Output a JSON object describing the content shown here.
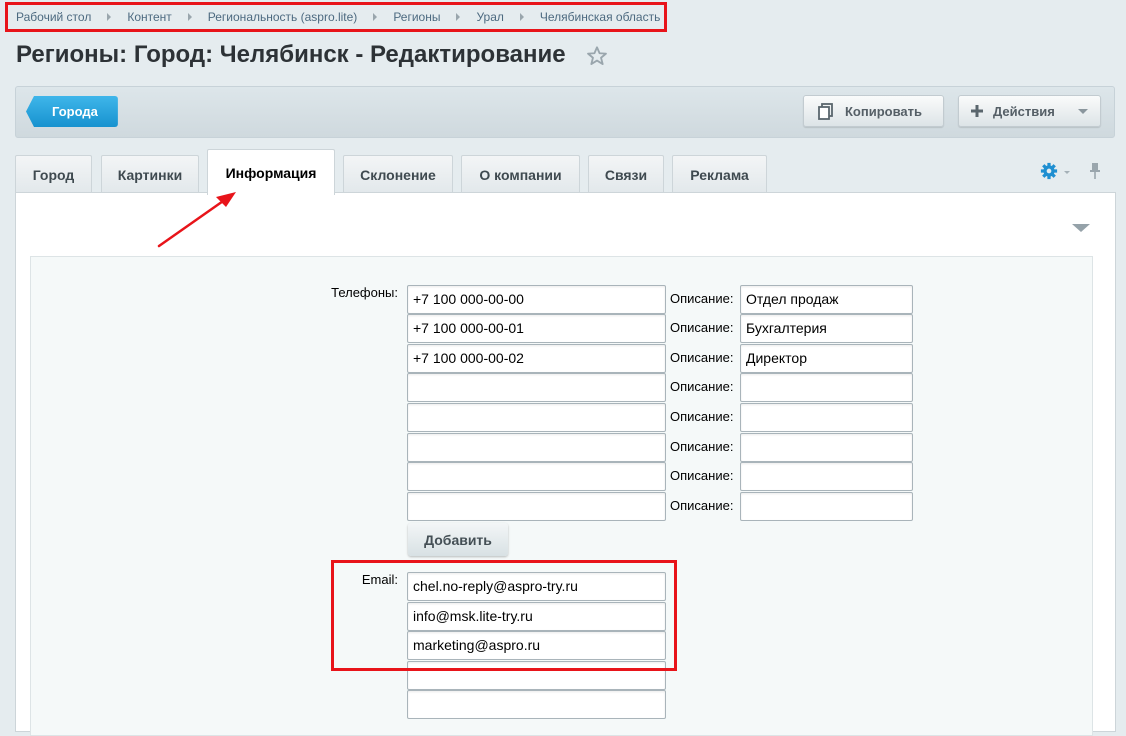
{
  "breadcrumb": [
    "Рабочий стол",
    "Контент",
    "Региональность (aspro.lite)",
    "Регионы",
    "Урал",
    "Челябинская область"
  ],
  "page_title": "Регионы: Город: Челябинск - Редактирование",
  "toolbar": {
    "back_label": "Города",
    "copy_label": "Копировать",
    "actions_label": "Действия"
  },
  "tabs": [
    "Город",
    "Картинки",
    "Информация",
    "Склонение",
    "О компании",
    "Связи",
    "Реклама"
  ],
  "active_tab": "Информация",
  "phones_label": "Телефоны:",
  "description_label": "Описание:",
  "phones": [
    {
      "number": "+7 100 000-00-00",
      "description": "Отдел продаж"
    },
    {
      "number": "+7 100 000-00-01",
      "description": "Бухгалтерия"
    },
    {
      "number": "+7 100 000-00-02",
      "description": "Директор"
    },
    {
      "number": "",
      "description": ""
    },
    {
      "number": "",
      "description": ""
    },
    {
      "number": "",
      "description": ""
    },
    {
      "number": "",
      "description": ""
    },
    {
      "number": "",
      "description": ""
    }
  ],
  "add_label": "Добавить",
  "email_label": "Email:",
  "emails": [
    "chel.no-reply@aspro-try.ru",
    "info@msk.lite-try.ru",
    "marketing@aspro.ru",
    "",
    ""
  ],
  "colors": {
    "accent": "#1fa0dc",
    "highlight": "#e8141a",
    "background": "#e5ecef"
  },
  "icons": [
    "star-icon",
    "copy-icon",
    "plus-icon",
    "gear-icon",
    "pin-icon",
    "collapse-icon"
  ]
}
